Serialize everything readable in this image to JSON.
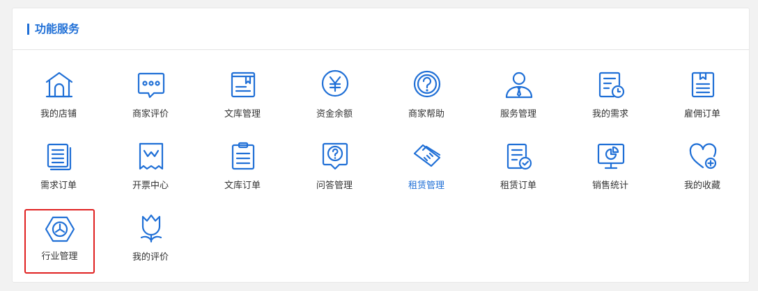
{
  "panel": {
    "title": "功能服务"
  },
  "items": [
    {
      "label": "我的店铺",
      "icon": "store-icon"
    },
    {
      "label": "商家评价",
      "icon": "chat-bubble-icon"
    },
    {
      "label": "文库管理",
      "icon": "library-book-icon"
    },
    {
      "label": "资金余额",
      "icon": "yuan-coin-icon"
    },
    {
      "label": "商家帮助",
      "icon": "help-question-icon"
    },
    {
      "label": "服务管理",
      "icon": "service-person-icon"
    },
    {
      "label": "我的需求",
      "icon": "demand-clock-icon"
    },
    {
      "label": "雇佣订单",
      "icon": "hire-order-icon"
    },
    {
      "label": "需求订单",
      "icon": "demand-order-icon"
    },
    {
      "label": "开票中心",
      "icon": "invoice-receipt-icon"
    },
    {
      "label": "文库订单",
      "icon": "library-order-icon"
    },
    {
      "label": "问答管理",
      "icon": "qa-bubble-icon"
    },
    {
      "label": "租赁管理",
      "icon": "handshake-icon"
    },
    {
      "label": "租赁订单",
      "icon": "lease-order-check-icon"
    },
    {
      "label": "销售统计",
      "icon": "sales-chart-icon"
    },
    {
      "label": "我的收藏",
      "icon": "favorite-heart-icon"
    },
    {
      "label": "行业管理",
      "icon": "industry-hexagon-icon"
    },
    {
      "label": "我的评价",
      "icon": "tulip-review-icon"
    }
  ],
  "active_item": "租赁管理",
  "selected_item": "行业管理",
  "colors": {
    "accent": "#1f6fd6",
    "selection": "#e02020",
    "text": "#333333"
  }
}
